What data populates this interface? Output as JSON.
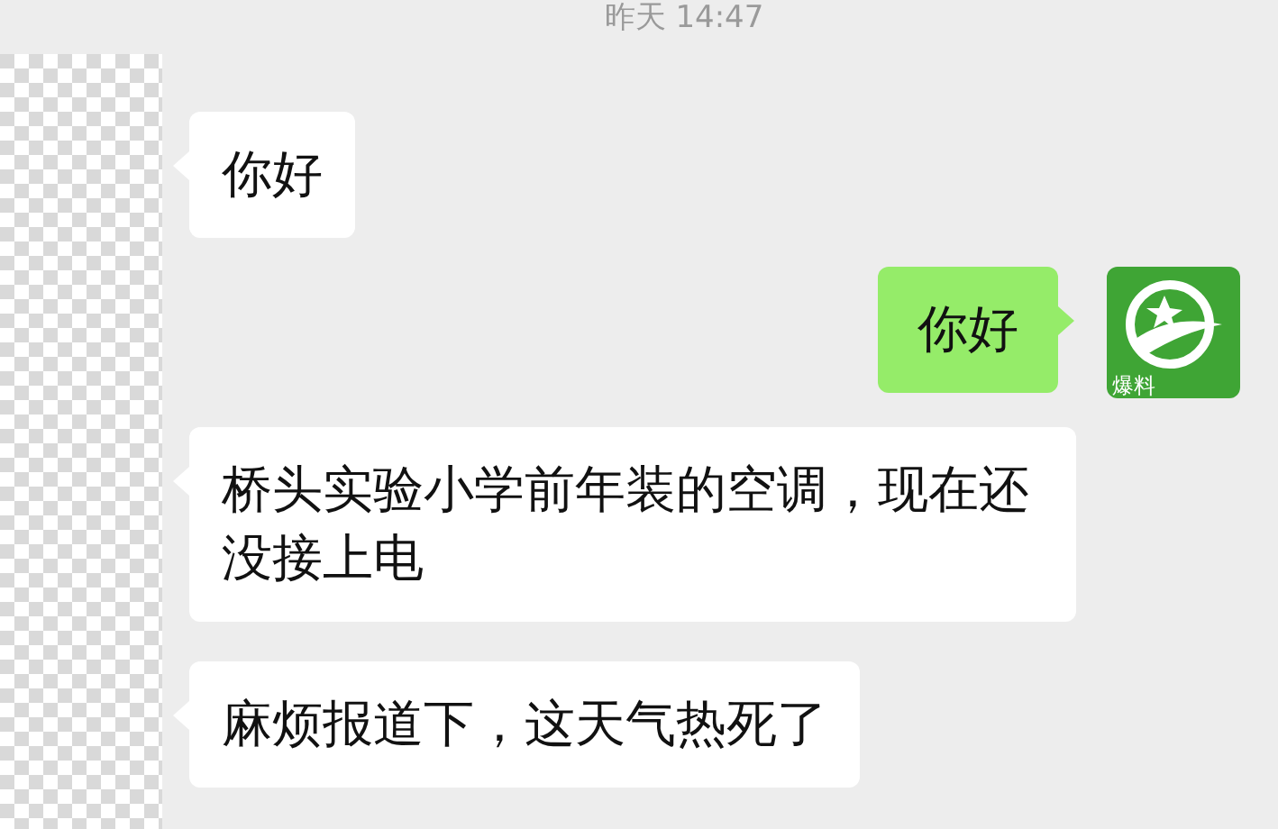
{
  "timestamp": "昨天 14:47",
  "messages": [
    {
      "kind": "received",
      "text": "你好"
    },
    {
      "kind": "sent",
      "text": "你好",
      "avatar_label": "爆料"
    },
    {
      "kind": "received",
      "text": "桥头实验小学前年装的空调，现在还没接上电"
    },
    {
      "kind": "received",
      "text": "麻烦报道下，这天气热死了"
    }
  ]
}
